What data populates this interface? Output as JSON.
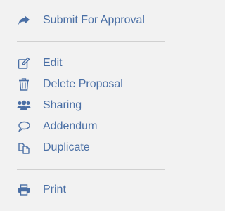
{
  "colors": {
    "accent": "#4a6fa5",
    "divider": "#d0d0d0",
    "background": "#f2f2f2"
  },
  "menu": {
    "sections": [
      {
        "items": [
          {
            "id": "submit",
            "label": "Submit For Approval",
            "icon": "share-arrow-icon"
          }
        ]
      },
      {
        "items": [
          {
            "id": "edit",
            "label": "Edit",
            "icon": "edit-icon"
          },
          {
            "id": "delete",
            "label": "Delete Proposal",
            "icon": "trash-icon"
          },
          {
            "id": "sharing",
            "label": "Sharing",
            "icon": "users-icon"
          },
          {
            "id": "addendum",
            "label": "Addendum",
            "icon": "comment-icon"
          },
          {
            "id": "duplicate",
            "label": "Duplicate",
            "icon": "copy-icon"
          }
        ]
      },
      {
        "items": [
          {
            "id": "print",
            "label": "Print",
            "icon": "print-icon"
          }
        ]
      }
    ]
  }
}
